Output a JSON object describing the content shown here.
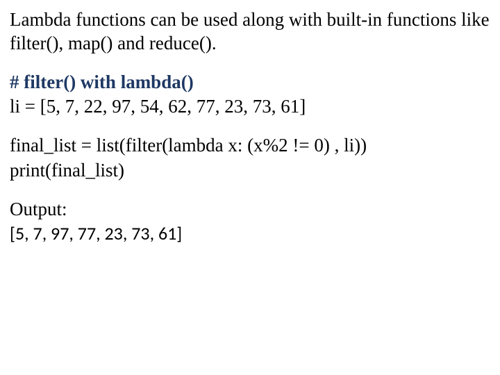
{
  "intro": "Lambda functions can be used along with built-in functions like filter(), map() and reduce().",
  "code": {
    "heading": "# filter() with lambda()",
    "line1": "li = [5, 7, 22, 97, 54, 62, 77, 23, 73, 61]",
    "line2": "final_list = list(filter(lambda x: (x%2 != 0) , li))",
    "line3": "print(final_list)"
  },
  "output": {
    "label": "Output:",
    "value": "[5, 7, 97, 77, 23, 73, 61]"
  }
}
